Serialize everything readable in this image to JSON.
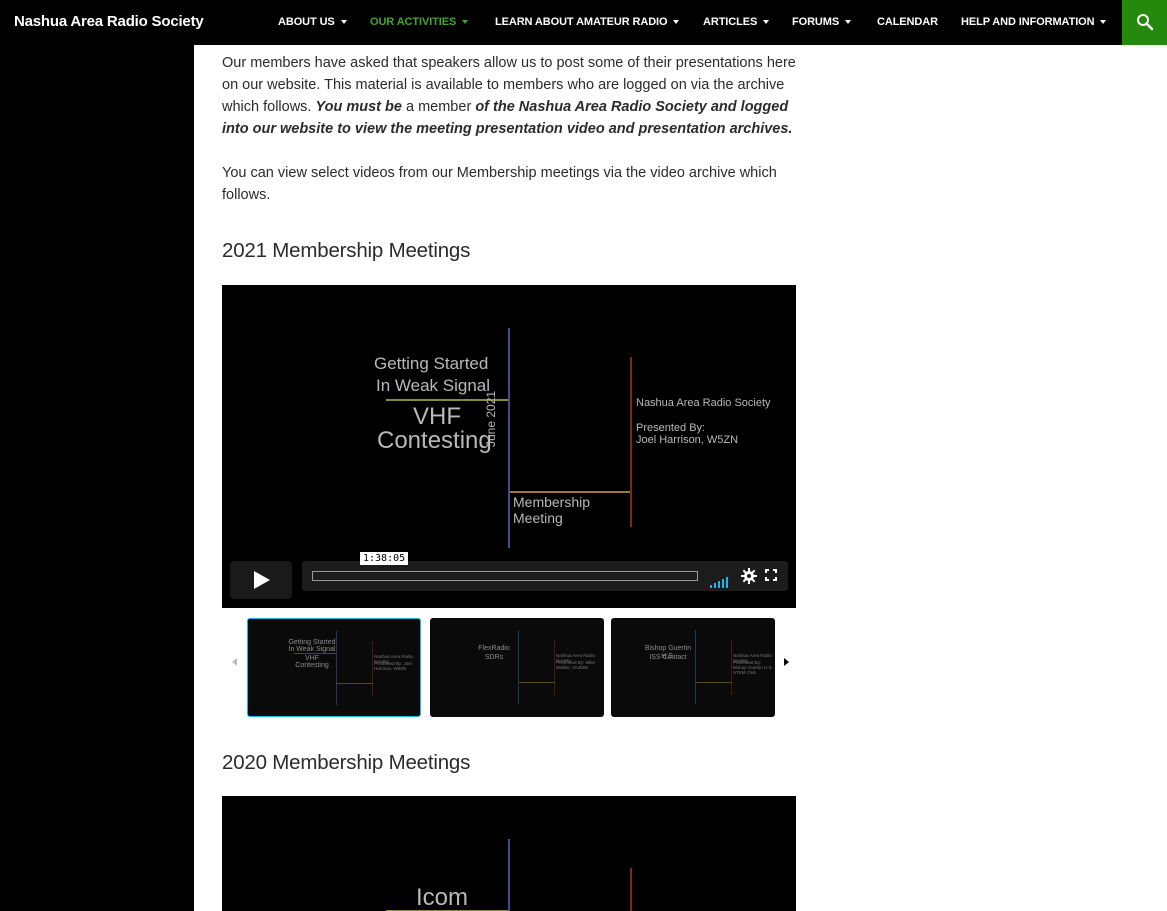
{
  "site": {
    "title": "Nashua Area Radio Society"
  },
  "nav": {
    "items": [
      {
        "label": "ABOUT US",
        "dropdown": true,
        "active": false
      },
      {
        "label": "OUR ACTIVITIES",
        "dropdown": true,
        "active": true
      },
      {
        "label": "LEARN ABOUT AMATEUR RADIO",
        "dropdown": true,
        "active": false
      },
      {
        "label": "ARTICLES",
        "dropdown": true,
        "active": false
      },
      {
        "label": "FORUMS",
        "dropdown": true,
        "active": false
      },
      {
        "label": "CALENDAR",
        "dropdown": false,
        "active": false
      },
      {
        "label": "HELP AND INFORMATION",
        "dropdown": true,
        "active": false
      }
    ],
    "search_icon": "search-icon"
  },
  "intro": {
    "p1_start": "Our members have asked that speakers allow us to post some of their presentations here on our website. This material is available to members who are logged on via the archive which follows. ",
    "p1_bold1": "You must be",
    "p1_mid": " a member ",
    "p1_bold2": "of the Nashua Area Radio Society and logged into our website to view the meeting presentation video and presentation archives.",
    "p2": "You can view select videos from our Membership meetings via the video archive which follows."
  },
  "sections": [
    {
      "heading": "2021 Membership Meetings",
      "video": {
        "title_small_1": "Getting Started",
        "title_small_2": "In Weak Signal",
        "title_big_1": "VHF",
        "title_big_2": "Contesting",
        "date": "June 2021",
        "meeting_1": "Membership",
        "meeting_2": "Meeting",
        "org": "Nashua Area Radio Society",
        "presented_by": "Presented By:",
        "presenter": "Joel Harrison, W5ZN",
        "timecode": "1:38:05"
      },
      "thumbnails": [
        {
          "line1": "Getting Started",
          "line2": "In Weak Signal",
          "line3": "VHF",
          "line4": "Contesting",
          "org": "Nashua Area Radio Society",
          "presenter": "Presented By: Joel Harrison, W5ZN"
        },
        {
          "line1": "FlexRadio",
          "line2": "SDRs",
          "line3": "",
          "line4": "",
          "org": "Nashua Area Radio Society",
          "presenter": "Presented By: Mike Walker, VA3MW"
        },
        {
          "line1": "Bishop Guertin H.S.",
          "line2": "ISS Contact",
          "line3": "",
          "line4": "",
          "org": "Nashua Area Radio Society",
          "presenter": "Presented By: Bishop Guertin H.S. STEM Club"
        }
      ]
    },
    {
      "heading": "2020 Membership Meetings",
      "video": {
        "title_big_1": "Icom"
      }
    }
  ],
  "colors": {
    "accent_green": "#41a62a",
    "search_bg": "#24890d",
    "vimeo_blue": "#1ab7ea"
  }
}
